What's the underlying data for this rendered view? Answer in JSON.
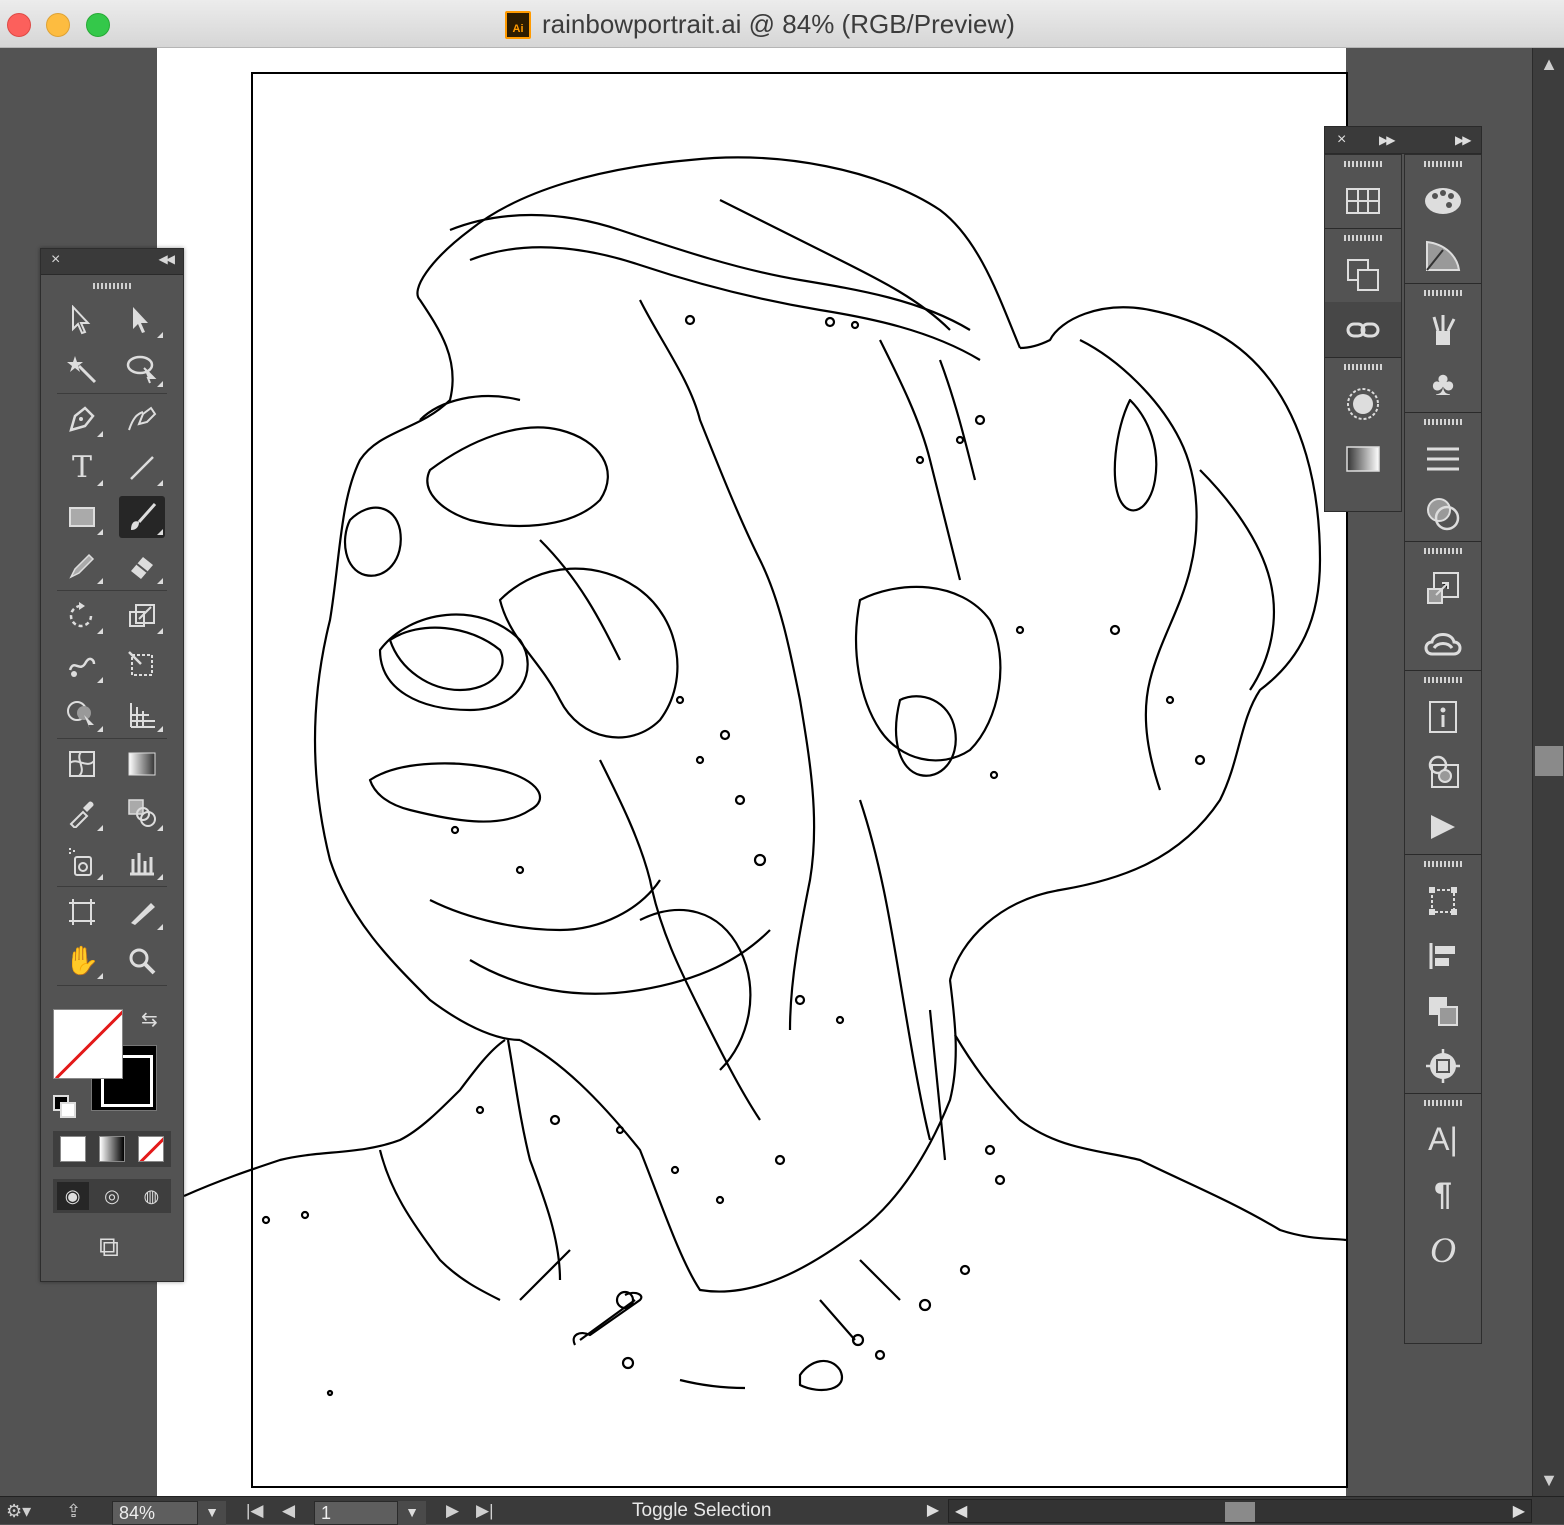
{
  "window": {
    "title": "rainbowportrait.ai @ 84% (RGB/Preview)",
    "doc_icon_label": "Ai"
  },
  "colors": {
    "workspace": "#535353",
    "panel_header": "#3a3a3a",
    "no_fill_red": "#e31919",
    "traffic_close": "#fc605c",
    "traffic_min": "#fdbc40",
    "traffic_max": "#34c84a"
  },
  "tools_panel": {
    "rows": [
      [
        "selection-tool",
        "direct-selection-tool"
      ],
      [
        "magic-wand-tool",
        "lasso-tool"
      ],
      [
        "pen-tool",
        "curvature-tool"
      ],
      [
        "type-tool",
        "line-segment-tool"
      ],
      [
        "rectangle-tool",
        "paintbrush-tool"
      ],
      [
        "pencil-tool",
        "eraser-tool"
      ],
      [
        "rotate-tool",
        "scale-tool"
      ],
      [
        "warp-tool",
        "free-transform-tool"
      ],
      [
        "shape-builder-tool",
        "perspective-grid-tool"
      ],
      [
        "mesh-tool",
        "gradient-tool"
      ],
      [
        "eyedropper-tool",
        "blend-tool"
      ],
      [
        "symbol-sprayer-tool",
        "column-graph-tool"
      ],
      [
        "artboard-tool",
        "slice-tool"
      ],
      [
        "hand-tool",
        "zoom-tool"
      ]
    ],
    "active_tool": "paintbrush-tool",
    "fill": "none",
    "stroke": "#000000"
  },
  "dock": {
    "column1": [
      [
        "swatches-grid-icon"
      ],
      [
        "artboards-icon",
        "links-icon"
      ],
      [
        "appearance-icon",
        "gradient-panel-icon"
      ]
    ],
    "column2": [
      [
        "color-palette-icon",
        "color-guide-icon"
      ],
      [
        "brushes-icon",
        "symbols-icon"
      ],
      [
        "stroke-icon",
        "transparency-icon"
      ],
      [
        "asset-export-icon",
        "cc-libraries-icon"
      ],
      [
        "document-info-icon",
        "image-trace-icon",
        "actions-icon"
      ],
      [
        "transform-icon",
        "align-icon",
        "pathfinder-icon",
        "navigator-icon"
      ],
      [
        "character-icon",
        "paragraph-icon",
        "opentype-icon"
      ]
    ]
  },
  "statusbar": {
    "zoom": "84%",
    "page": "1",
    "status_text": "Toggle Selection"
  }
}
